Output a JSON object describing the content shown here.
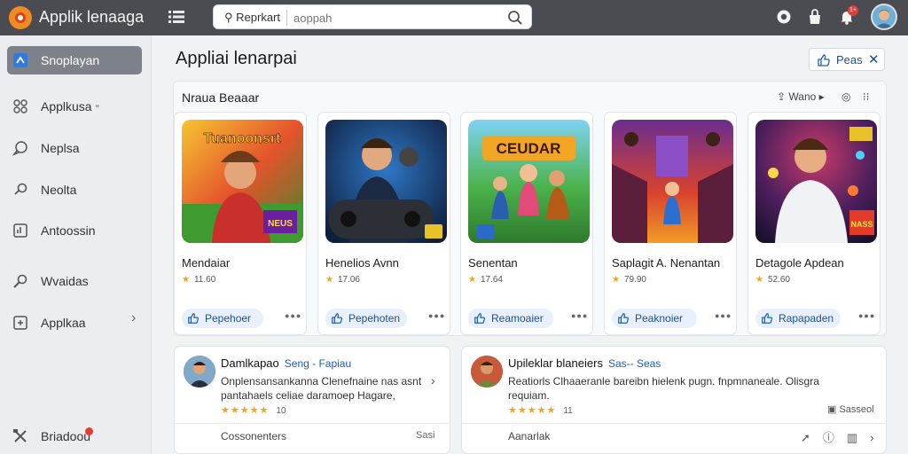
{
  "topbar": {
    "title": "Applik lenaaga",
    "search": {
      "lead_label": "Reprkart",
      "placeholder": "aoppah"
    },
    "notification_count": "1+",
    "icons": [
      "logo-icon",
      "menu-icon",
      "search-icon",
      "record-icon",
      "bag-icon",
      "bell-icon",
      "avatar"
    ]
  },
  "sidebar": {
    "items": [
      {
        "label": "Snoplayan",
        "icon": "puzzle-icon",
        "active": true
      },
      {
        "label": "Applkusa",
        "icon": "grid-icon",
        "suffix": "❞"
      },
      {
        "label": "Neplsa",
        "icon": "chat-icon"
      },
      {
        "label": "Neolta",
        "icon": "link-icon"
      },
      {
        "label": "Antoossin",
        "icon": "chart-icon"
      },
      {
        "label": "Wvaidas",
        "icon": "edit-icon"
      },
      {
        "label": "Applkaa",
        "icon": "box-icon"
      },
      {
        "label": "Briadoou",
        "icon": "tools-icon"
      }
    ]
  },
  "main": {
    "title": "Appliai lenarpai",
    "top_action": "Peas",
    "section": {
      "title": "Nraua Beaaar",
      "control": "Wano",
      "cards": [
        {
          "name": "Mendaiar",
          "rating": "11.60",
          "button": "Pepehoer",
          "art_title": "Tuanoonsrt",
          "art_badge": "NEUS"
        },
        {
          "name": "Henelios Avnn",
          "rating": "17.06",
          "button": "Pepehoten",
          "art_title": "",
          "art_badge": ""
        },
        {
          "name": "Senentan",
          "rating": "17.64",
          "button": "Reamoaier",
          "art_title": "CEUDAR",
          "art_badge": ""
        },
        {
          "name": "Saplagit A. Nenantan",
          "rating": "79.90",
          "button": "Peaknoier",
          "art_title": "",
          "art_badge": ""
        },
        {
          "name": "Detagole Apdean",
          "rating": "52.60",
          "button": "Rapapaden",
          "art_title": "",
          "art_badge": "NASS"
        }
      ]
    },
    "reviews": [
      {
        "name": "Damlkapao",
        "tag": "Seng - Fapiau",
        "text": [
          "Onplensansankanna Clenefnaine nas asnt",
          "pantahaels celiae daramoep Hagare,"
        ],
        "stars": "★★★★★",
        "score": "10",
        "footer": "Cossonenters",
        "footer_right": "Sasi"
      },
      {
        "name": "Upileklar blaneiers",
        "tag": "Sas-- Seas",
        "text": [
          "Reatiorls Clhaaeranle bareibn hielenk pugn. fnpmnaneale. Olisgra",
          "requiam."
        ],
        "stars": "★★★★★",
        "score": "11",
        "footer": "Aanarlak",
        "footer_right": "Sasseol"
      }
    ]
  },
  "colors": {
    "accent": "#1f5fb0",
    "topbar": "#4a4c52",
    "star": "#f2a21b",
    "badge": "#e53b36"
  }
}
